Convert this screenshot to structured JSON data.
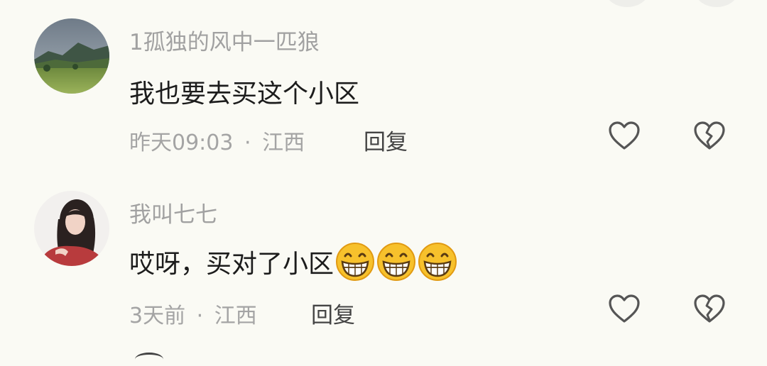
{
  "comments": [
    {
      "username": "1孤独的风中一匹狼",
      "text": "我也要去买这个小区",
      "time": "昨天09:03",
      "separator": "·",
      "location": "江西",
      "reply_label": "回复",
      "avatar_icon": "landscape-avatar",
      "emojis": []
    },
    {
      "username": "我叫七七",
      "text": "哎呀，买对了小区",
      "time": "3天前",
      "separator": "·",
      "location": "江西",
      "reply_label": "回复",
      "avatar_icon": "girl-portrait-avatar",
      "emojis": [
        "grinning-face-icon",
        "grinning-face-icon",
        "grinning-face-icon"
      ]
    }
  ],
  "icons": {
    "like": "heart-icon",
    "dislike": "broken-heart-icon"
  },
  "colors": {
    "background": "#fafaf4",
    "username": "#a1a1a1",
    "text": "#1c1c1c",
    "meta": "#a4a4a4",
    "icon": "#555555"
  }
}
